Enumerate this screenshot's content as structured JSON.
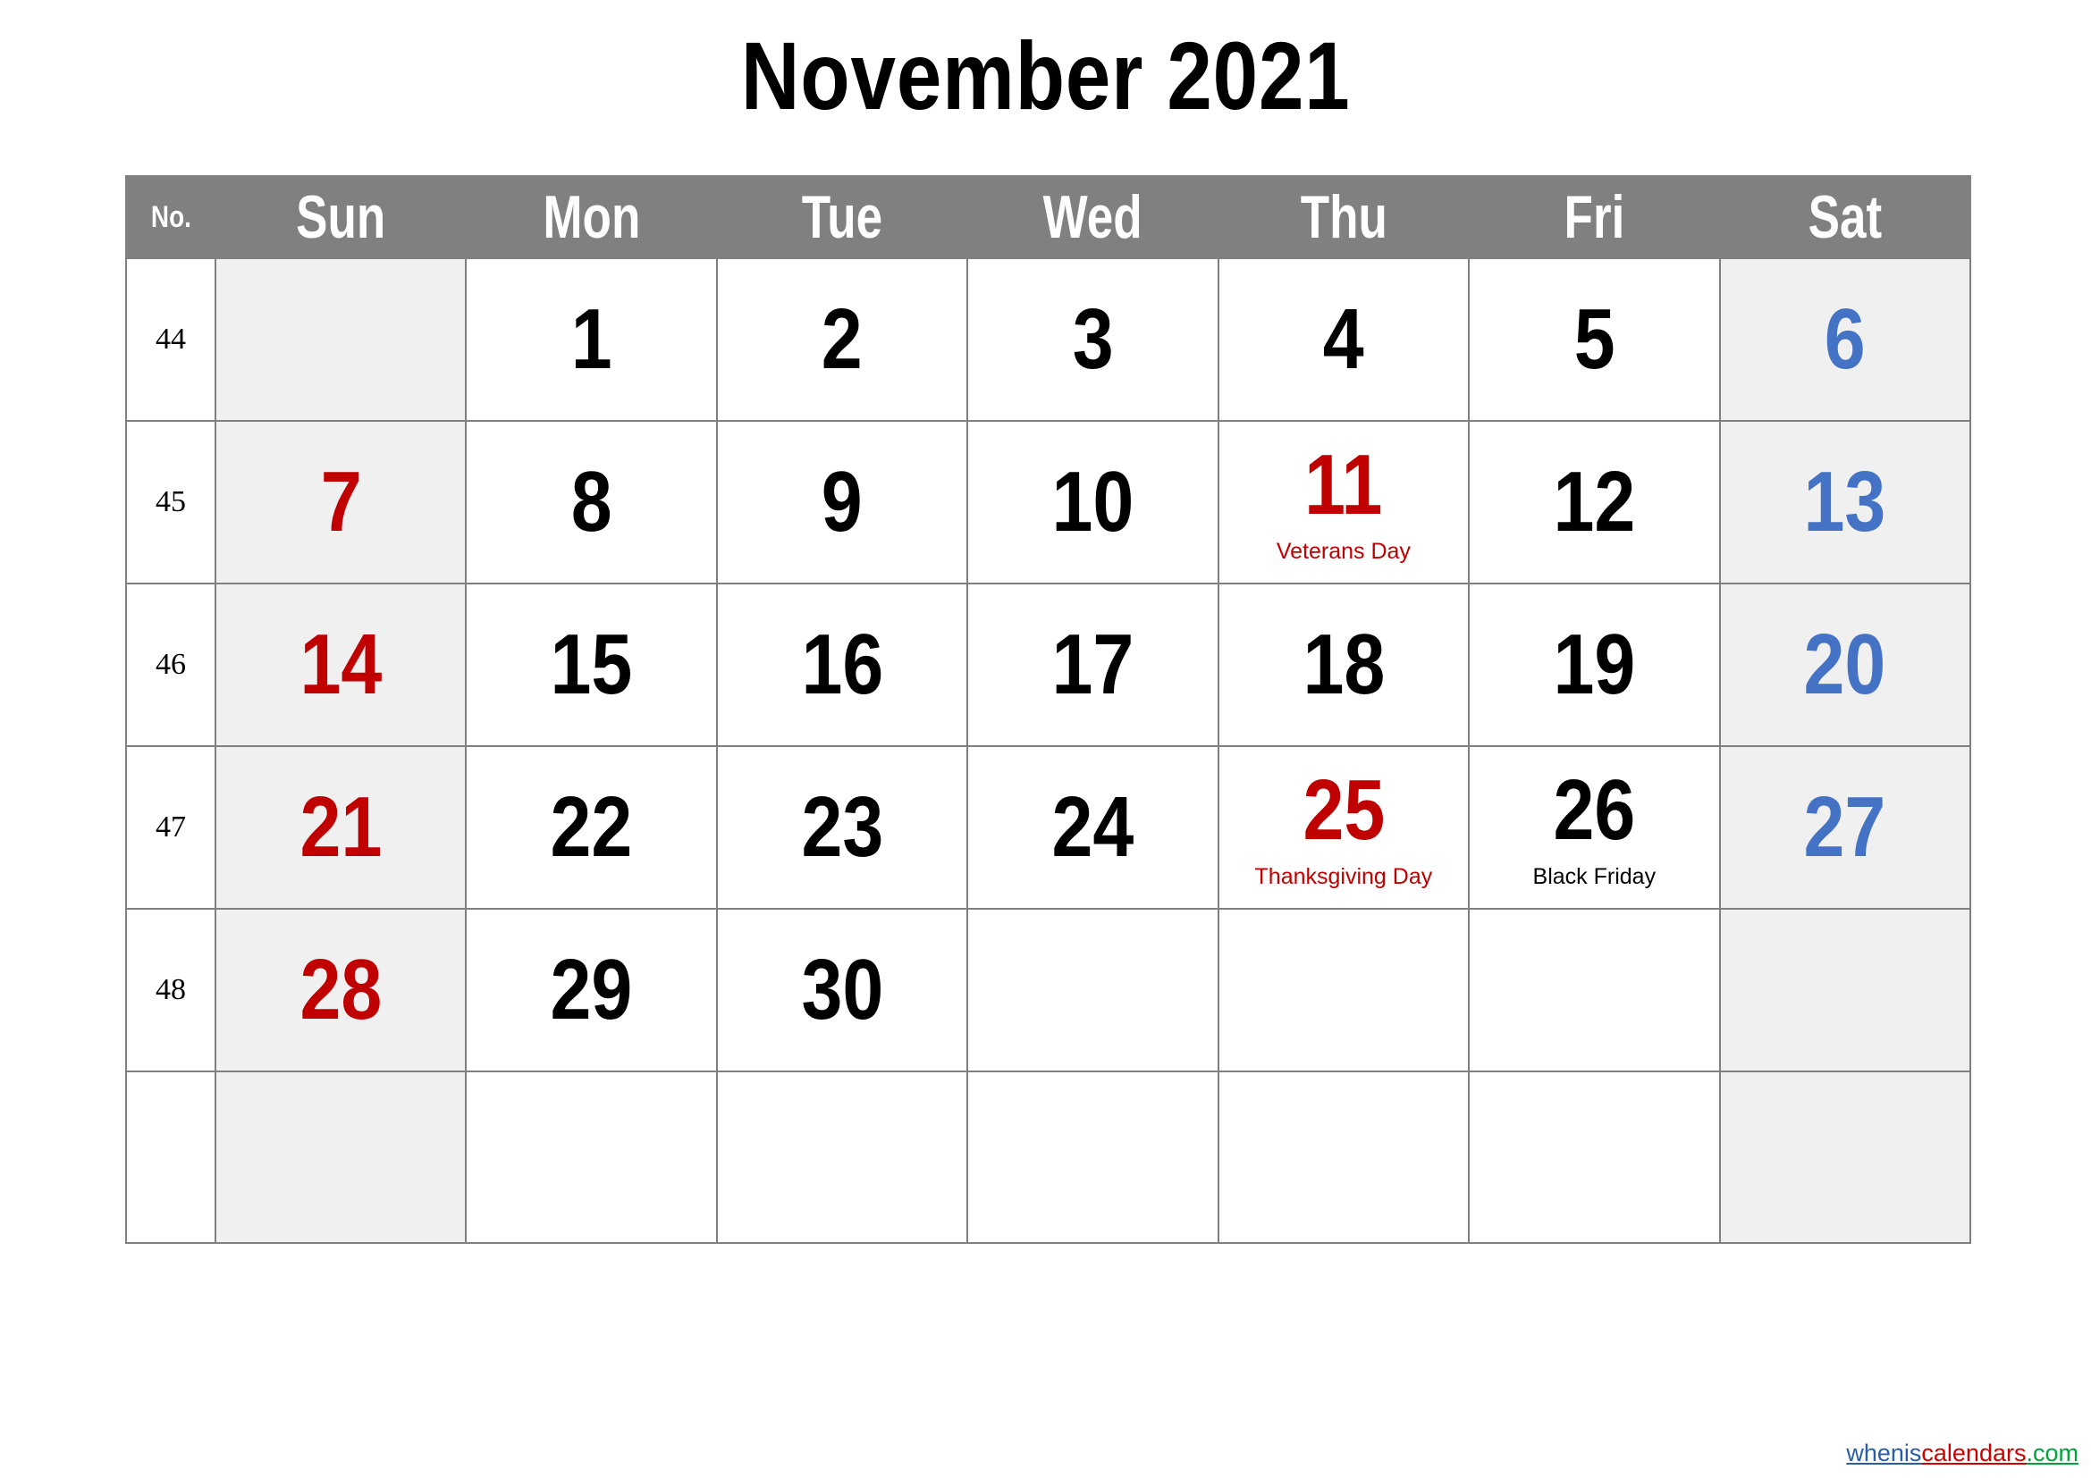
{
  "title": "November 2021",
  "header": {
    "week_no_label": "No.",
    "days": [
      "Sun",
      "Mon",
      "Tue",
      "Wed",
      "Thu",
      "Fri",
      "Sat"
    ]
  },
  "colors": {
    "header_bg": "#808080",
    "header_text": "#ffffff",
    "weekend_bg": "#f0f0f0",
    "sunday_text": "#c00000",
    "saturday_text": "#4472c4",
    "weekday_text": "#000000",
    "holiday_text": "#c00000",
    "grid_line": "#808080"
  },
  "weeks": [
    {
      "no": "44",
      "days": [
        {
          "num": "",
          "event": "",
          "event_color": ""
        },
        {
          "num": "1",
          "event": "",
          "event_color": ""
        },
        {
          "num": "2",
          "event": "",
          "event_color": ""
        },
        {
          "num": "3",
          "event": "",
          "event_color": ""
        },
        {
          "num": "4",
          "event": "",
          "event_color": ""
        },
        {
          "num": "5",
          "event": "",
          "event_color": ""
        },
        {
          "num": "6",
          "event": "",
          "event_color": ""
        }
      ]
    },
    {
      "no": "45",
      "days": [
        {
          "num": "7",
          "event": "",
          "event_color": ""
        },
        {
          "num": "8",
          "event": "",
          "event_color": ""
        },
        {
          "num": "9",
          "event": "",
          "event_color": ""
        },
        {
          "num": "10",
          "event": "",
          "event_color": ""
        },
        {
          "num": "11",
          "event": "Veterans Day",
          "event_color": "red"
        },
        {
          "num": "12",
          "event": "",
          "event_color": ""
        },
        {
          "num": "13",
          "event": "",
          "event_color": ""
        }
      ]
    },
    {
      "no": "46",
      "days": [
        {
          "num": "14",
          "event": "",
          "event_color": ""
        },
        {
          "num": "15",
          "event": "",
          "event_color": ""
        },
        {
          "num": "16",
          "event": "",
          "event_color": ""
        },
        {
          "num": "17",
          "event": "",
          "event_color": ""
        },
        {
          "num": "18",
          "event": "",
          "event_color": ""
        },
        {
          "num": "19",
          "event": "",
          "event_color": ""
        },
        {
          "num": "20",
          "event": "",
          "event_color": ""
        }
      ]
    },
    {
      "no": "47",
      "days": [
        {
          "num": "21",
          "event": "",
          "event_color": ""
        },
        {
          "num": "22",
          "event": "",
          "event_color": ""
        },
        {
          "num": "23",
          "event": "",
          "event_color": ""
        },
        {
          "num": "24",
          "event": "",
          "event_color": ""
        },
        {
          "num": "25",
          "event": "Thanksgiving Day",
          "event_color": "red"
        },
        {
          "num": "26",
          "event": "Black Friday",
          "event_color": "black"
        },
        {
          "num": "27",
          "event": "",
          "event_color": ""
        }
      ]
    },
    {
      "no": "48",
      "days": [
        {
          "num": "28",
          "event": "",
          "event_color": ""
        },
        {
          "num": "29",
          "event": "",
          "event_color": ""
        },
        {
          "num": "30",
          "event": "",
          "event_color": ""
        },
        {
          "num": "",
          "event": "",
          "event_color": ""
        },
        {
          "num": "",
          "event": "",
          "event_color": ""
        },
        {
          "num": "",
          "event": "",
          "event_color": ""
        },
        {
          "num": "",
          "event": "",
          "event_color": ""
        }
      ]
    },
    {
      "no": "",
      "days": [
        {
          "num": "",
          "event": "",
          "event_color": ""
        },
        {
          "num": "",
          "event": "",
          "event_color": ""
        },
        {
          "num": "",
          "event": "",
          "event_color": ""
        },
        {
          "num": "",
          "event": "",
          "event_color": ""
        },
        {
          "num": "",
          "event": "",
          "event_color": ""
        },
        {
          "num": "",
          "event": "",
          "event_color": ""
        },
        {
          "num": "",
          "event": "",
          "event_color": ""
        }
      ]
    }
  ],
  "watermark": {
    "part1": "whenis",
    "part2": "calendars",
    "part3": ".com"
  }
}
